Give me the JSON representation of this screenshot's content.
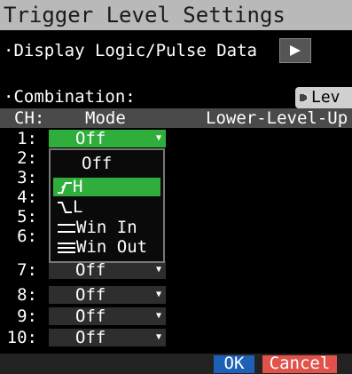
{
  "window": {
    "title": "Trigger Level Settings"
  },
  "display_logic": {
    "label": "·Display Logic/Pulse Data"
  },
  "combination": {
    "label": "·Combination:",
    "button_label": "Lev"
  },
  "table": {
    "headers": {
      "ch": "CH:",
      "mode": "Mode",
      "level": "Lower-Level-Up"
    },
    "rows": [
      {
        "ch": "1:",
        "mode": "Off"
      },
      {
        "ch": "2:",
        "mode": ""
      },
      {
        "ch": "3:",
        "mode": ""
      },
      {
        "ch": "4:",
        "mode": ""
      },
      {
        "ch": "5:",
        "mode": ""
      },
      {
        "ch": "6:",
        "mode": ""
      },
      {
        "ch": "7:",
        "mode": "Off"
      },
      {
        "ch": "8:",
        "mode": "Off"
      },
      {
        "ch": "9:",
        "mode": "Off"
      },
      {
        "ch": "10:",
        "mode": "Off"
      }
    ]
  },
  "dropdown": {
    "selected": "H",
    "options": [
      {
        "label": "Off",
        "icon": ""
      },
      {
        "label": "H",
        "icon": "rising-edge-icon"
      },
      {
        "label": "L",
        "icon": "falling-edge-icon"
      },
      {
        "label": "Win In",
        "icon": "window-in-icon"
      },
      {
        "label": "Win Out",
        "icon": "window-out-icon"
      }
    ]
  },
  "buttons": {
    "ok": "OK",
    "cancel": "Cancel"
  },
  "colors": {
    "selected": "#2fae3c",
    "ok": "#1e5fb8",
    "cancel": "#e0524a",
    "title_bar": "#b9b9b9"
  }
}
